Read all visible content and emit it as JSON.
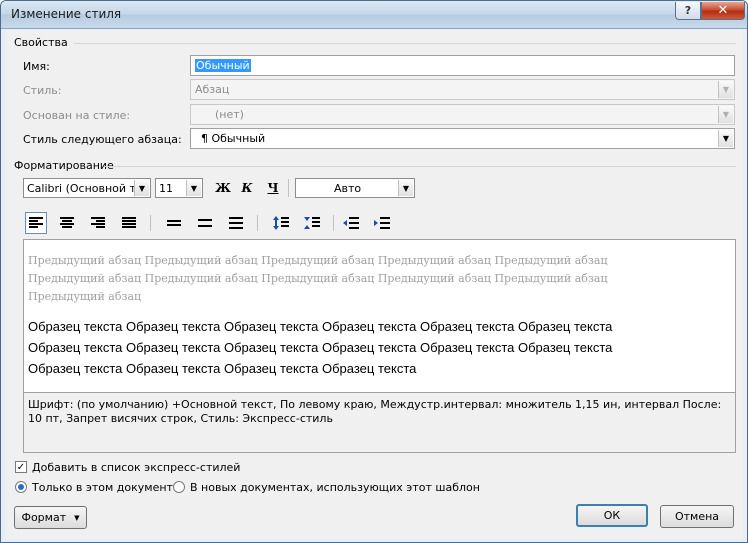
{
  "window": {
    "title": "Изменение стиля",
    "help_glyph": "?",
    "close_glyph": "✕"
  },
  "properties": {
    "section": "Свойства",
    "name_label": "Имя:",
    "name_value": "Обычный",
    "style_label": "Стиль:",
    "style_value": "Абзац",
    "based_on_label": "Основан на стиле:",
    "based_on_value": "(нет)",
    "next_label": "Стиль следующего абзаца:",
    "next_value": "¶ Обычный"
  },
  "formatting": {
    "section": "Форматирование",
    "font": "Calibri (Основной текст)",
    "size": "11",
    "bold": "Ж",
    "italic": "К",
    "underline": "Ч",
    "color": "Авто"
  },
  "preview": {
    "previous_paragraph": "Предыдущий абзац Предыдущий абзац Предыдущий абзац Предыдущий абзац Предыдущий абзац Предыдущий абзац Предыдущий абзац Предыдущий абзац Предыдущий абзац Предыдущий абзац Предыдущий абзац",
    "sample_text": "Образец текста Образец текста Образец текста Образец текста Образец текста Образец текста Образец текста Образец текста Образец текста Образец текста Образец текста Образец текста Образец текста Образец текста Образец текста Образец текста"
  },
  "description": "Шрифт: (по умолчанию) +Основной текст, По левому краю, Междустр.интервал:  множитель 1,15 ин, интервал После:  10 пт, Запрет висячих строк, Стиль: Экспресс-стиль",
  "options": {
    "add_quick": "Добавить в список экспресс-стилей",
    "add_quick_checked": true,
    "only_doc": "Только в этом документе",
    "new_docs": "В новых документах, использующих этот шаблон",
    "selected": "only_doc"
  },
  "buttons": {
    "format": "Формат",
    "ok": "ОК",
    "cancel": "Отмена"
  }
}
